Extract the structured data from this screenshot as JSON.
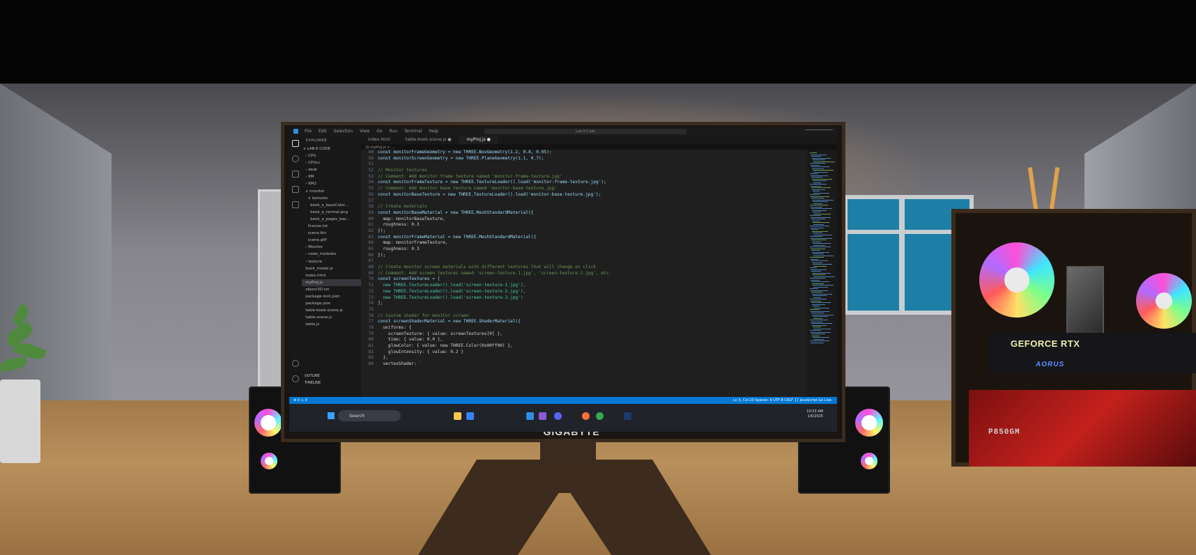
{
  "scene": {
    "monitor_brand": "GIGABYTE",
    "gpu_label": "GEFORCE RTX",
    "gpu_brand": "AORUS",
    "psu_label": "P850GM"
  },
  "vscode": {
    "menu": [
      "File",
      "Edit",
      "Selection",
      "View",
      "Go",
      "Run",
      "Terminal",
      "Help"
    ],
    "command_center": "Lab 6 Code",
    "sidebar_title": "EXPLORER",
    "file_tree": [
      "∨ LAB 6 CODE",
      "  › CPU",
      "  › CPUcc",
      "  › desk",
      "  › KM",
      "  › KM2",
      "  ∨ monitor",
      "    ∨ textures",
      "      book_a_baseColor...",
      "      book_a_normal.png",
      "      book_a_pages_bas...",
      "    license.txt",
      "    scene.bin",
      "    scene.gltf",
      "  › Monitor",
      "  › node_modules",
      "  › texture",
      "  book_model.js",
      "  index.html",
      "  myProj.js",
      "  object3D.txt",
      "  package-lock.json",
      "  package.json",
      "  table-book-scene.js",
      "  table-scene.js",
      "  table.js"
    ],
    "outline_label": "OUTLINE",
    "timeline_label": "TIMELINE",
    "tabs": [
      "index.html",
      "table-book-scene.js ●",
      "myProj.js ●"
    ],
    "breadcrumb": "JS myProj.js > ...",
    "code_lines": [
      {
        "n": "49",
        "t": "const monitorFrameGeometry = new THREE.BoxGeometry(1.2, 0.8, 0.05);"
      },
      {
        "n": "50",
        "t": "const monitorScreenGeometry = new THREE.PlaneGeometry(1.1, 0.7);"
      },
      {
        "n": "51",
        "t": ""
      },
      {
        "n": "52",
        "t": "// Monitor textures"
      },
      {
        "n": "53",
        "t": "// Comment: Add monitor frame texture named 'monitor-frame-texture.jpg'"
      },
      {
        "n": "54",
        "t": "const monitorFrameTexture = new THREE.TextureLoader().load('monitor-frame-texture.jpg');"
      },
      {
        "n": "55",
        "t": "// Comment: Add monitor base texture named 'monitor-base-texture.jpg'"
      },
      {
        "n": "56",
        "t": "const monitorBaseTexture = new THREE.TextureLoader().load('monitor-base-texture.jpg');"
      },
      {
        "n": "57",
        "t": ""
      },
      {
        "n": "58",
        "t": "// Create materials"
      },
      {
        "n": "59",
        "t": "const monitorBaseMaterial = new THREE.MeshStandardMaterial({"
      },
      {
        "n": "60",
        "t": "  map: monitorBaseTexture,"
      },
      {
        "n": "61",
        "t": "  roughness: 0.3"
      },
      {
        "n": "62",
        "t": "});"
      },
      {
        "n": "63",
        "t": "const monitorFrameMaterial = new THREE.MeshStandardMaterial({"
      },
      {
        "n": "64",
        "t": "  map: monitorFrameTexture,"
      },
      {
        "n": "65",
        "t": "  roughness: 0.3"
      },
      {
        "n": "66",
        "t": "});"
      },
      {
        "n": "67",
        "t": ""
      },
      {
        "n": "68",
        "t": "// Create monitor screen materials with different textures that will change on click"
      },
      {
        "n": "69",
        "t": "// Comment: Add screen textures named 'screen-texture-1.jpg', 'screen-texture-2.jpg', etc."
      },
      {
        "n": "70",
        "t": "const screenTextures = ["
      },
      {
        "n": "71",
        "t": "  new THREE.TextureLoader().load('screen-texture-1.jpg'),"
      },
      {
        "n": "72",
        "t": "  new THREE.TextureLoader().load('screen-texture-2.jpg'),"
      },
      {
        "n": "73",
        "t": "  new THREE.TextureLoader().load('screen-texture-3.jpg')"
      },
      {
        "n": "74",
        "t": "];"
      },
      {
        "n": "75",
        "t": ""
      },
      {
        "n": "76",
        "t": "// Custom shader for monitor screen"
      },
      {
        "n": "77",
        "t": "const screenShaderMaterial = new THREE.ShaderMaterial({"
      },
      {
        "n": "78",
        "t": "  uniforms: {"
      },
      {
        "n": "79",
        "t": "    screenTexture: { value: screenTextures[0] },"
      },
      {
        "n": "80",
        "t": "    time: { value: 0.0 },"
      },
      {
        "n": "81",
        "t": "    glowColor: { value: new THREE.Color(0x00ff00) },"
      },
      {
        "n": "82",
        "t": "    glowIntensity: { value: 0.2 }"
      },
      {
        "n": "83",
        "t": "  },"
      },
      {
        "n": "84",
        "t": "  vertexShader: `"
      }
    ],
    "status_left": "⊗ 0 ⚠ 0",
    "status_right": "Ln 5, Col 20   Spaces: 4   UTF-8   CRLF   {} JavaScript   Go Live",
    "taskbar_search": "Search",
    "clock_time": "10:53 AM",
    "clock_date": "1/6/2025"
  },
  "colors": {
    "status_bar": "#0078d4",
    "comment": "#6a9955",
    "keyword": "#569cd6",
    "string": "#ce9178",
    "variable": "#9cdcfe",
    "class": "#4ec9b0",
    "number": "#b5cea8"
  }
}
